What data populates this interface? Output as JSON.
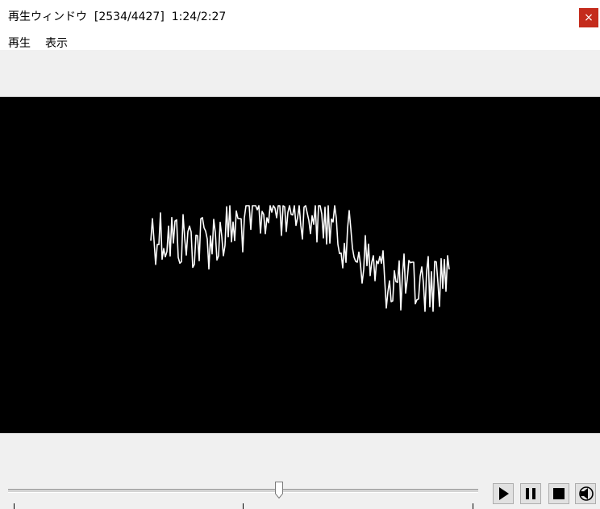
{
  "window": {
    "title": "再生ウィンドウ  [2534/4427]  1:24/2:27",
    "close_label": "×"
  },
  "menu": {
    "play_label": "再生",
    "view_label": "表示"
  },
  "playback": {
    "current_frame": 2534,
    "total_frames": 4427,
    "current_time": "1:24",
    "total_time": "2:27",
    "position_fraction": 0.577
  },
  "controls": {
    "icons": [
      "play-icon",
      "pause-icon",
      "stop-icon",
      "volume-icon"
    ]
  },
  "colors": {
    "close_button": "#c42b1c",
    "video_background": "#000000",
    "waveform": "#ffffff"
  }
}
